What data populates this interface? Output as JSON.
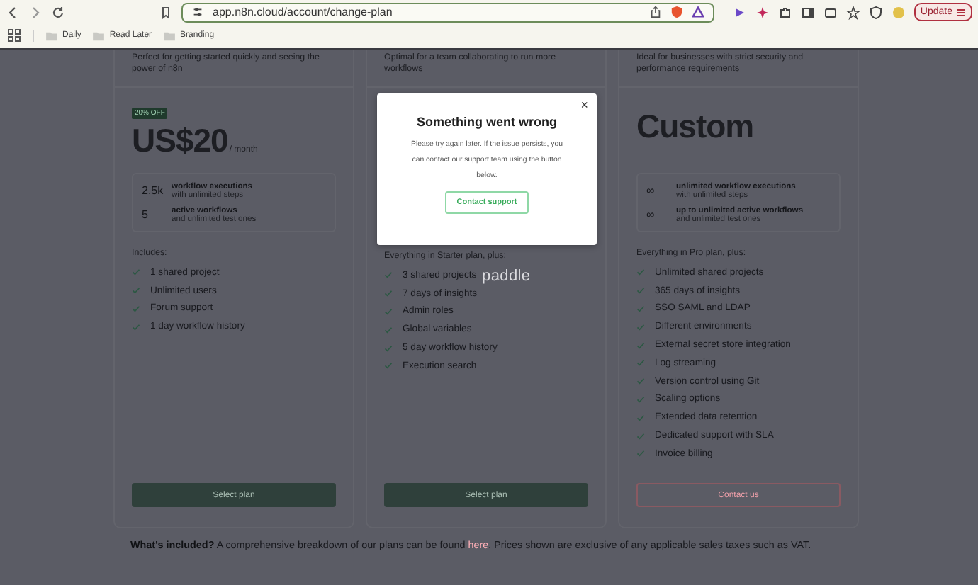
{
  "browser": {
    "url": "app.n8n.cloud/account/change-plan",
    "update_button": "Update",
    "bookmarks": [
      "Daily",
      "Read Later",
      "Branding"
    ]
  },
  "plans": [
    {
      "description": "Perfect for getting started quickly and seeing the power of n8n",
      "badge": "20% OFF",
      "price": "US$20",
      "period": "/ month",
      "limits": [
        {
          "amount": "2.5k",
          "title": "workflow executions",
          "subtitle": "with unlimited steps"
        },
        {
          "amount": "5",
          "title": "active workflows",
          "subtitle": "and unlimited test ones"
        }
      ],
      "includes_label": "Includes:",
      "features": [
        "1 shared project",
        "Unlimited users",
        "Forum support",
        "1 day workflow history"
      ],
      "button": {
        "label": "Select plan",
        "kind": "primary"
      }
    },
    {
      "description": "Optimal for a team collaborating to run more workflows",
      "includes_label": "Everything in Starter plan, plus:",
      "features": [
        "3 shared projects",
        "7 days of insights",
        "Admin roles",
        "Global variables",
        "5 day workflow history",
        "Execution search"
      ],
      "button": {
        "label": "Select plan",
        "kind": "primary"
      }
    },
    {
      "description": "Ideal for businesses with strict security and performance requirements",
      "price": "Custom",
      "limits": [
        {
          "amount": "∞",
          "title": "unlimited workflow executions",
          "subtitle": "with unlimited steps"
        },
        {
          "amount": "∞",
          "title": "up to unlimited active workflows",
          "subtitle": "and unlimited test ones"
        }
      ],
      "includes_label": "Everything in Pro plan, plus:",
      "features": [
        "Unlimited shared projects",
        "365 days of insights",
        "SSO SAML and LDAP",
        "Different environments",
        "External secret store integration",
        "Log streaming",
        "Version control using Git",
        "Scaling options",
        "Extended data retention",
        "Dedicated support with SLA",
        "Invoice billing"
      ],
      "button": {
        "label": "Contact us",
        "kind": "outline"
      }
    }
  ],
  "footer": {
    "text": "**What's included?**  A comprehensive breakdown of our plans can be found ",
    "link": "here",
    "after": ". Prices shown are exclusive of any applicable sales taxes such as VAT."
  },
  "modal": {
    "title": "Something went wrong",
    "message": "Please try again later. If the issue persists, you can contact our support team using the button below.",
    "button": "Contact support",
    "close": "×"
  },
  "overlay_logo": "paddle"
}
